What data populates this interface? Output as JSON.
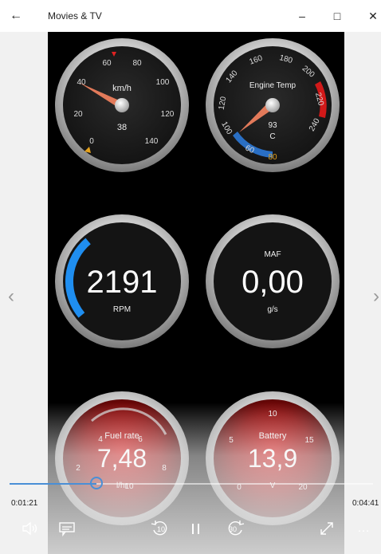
{
  "window": {
    "title": "Movies & TV",
    "back_icon": "←",
    "minimize_icon": "–",
    "maximize_icon": "□",
    "close_icon": "✕"
  },
  "navigation": {
    "prev_icon": "‹",
    "next_icon": "›"
  },
  "gauges": {
    "speed": {
      "unit": "km/h",
      "value": "38",
      "ticks": [
        "0",
        "20",
        "40",
        "60",
        "80",
        "100",
        "120",
        "140"
      ]
    },
    "engine_temp": {
      "label": "Engine Temp",
      "value": "93",
      "unit": "C",
      "ticks": [
        "80",
        "100",
        "120",
        "140",
        "160",
        "180",
        "200",
        "220",
        "240"
      ],
      "low_tick": "60"
    },
    "rpm": {
      "value": "2191",
      "unit": "RPM",
      "level": 0.28
    },
    "maf": {
      "label": "MAF",
      "value": "0,00",
      "unit": "g/s"
    },
    "fuel_rate": {
      "label": "Fuel rate",
      "value": "7,48",
      "unit": "l/hr",
      "ticks": [
        "2",
        "4",
        "6",
        "8",
        "10"
      ]
    },
    "battery": {
      "label": "Battery",
      "value": "13,9",
      "unit": "V",
      "ticks": [
        "0",
        "5",
        "10",
        "15",
        "20"
      ]
    }
  },
  "player": {
    "elapsed": "0:01:21",
    "remaining": "0:04:41",
    "progress": 0.24,
    "volume_icon": "volume-icon",
    "subtitles_icon": "subtitles-icon",
    "skip_back_label": "10",
    "pause_icon": "pause-icon",
    "skip_forward_label": "30",
    "fullscreen_icon": "fullscreen-icon",
    "more_icon": "…"
  }
}
